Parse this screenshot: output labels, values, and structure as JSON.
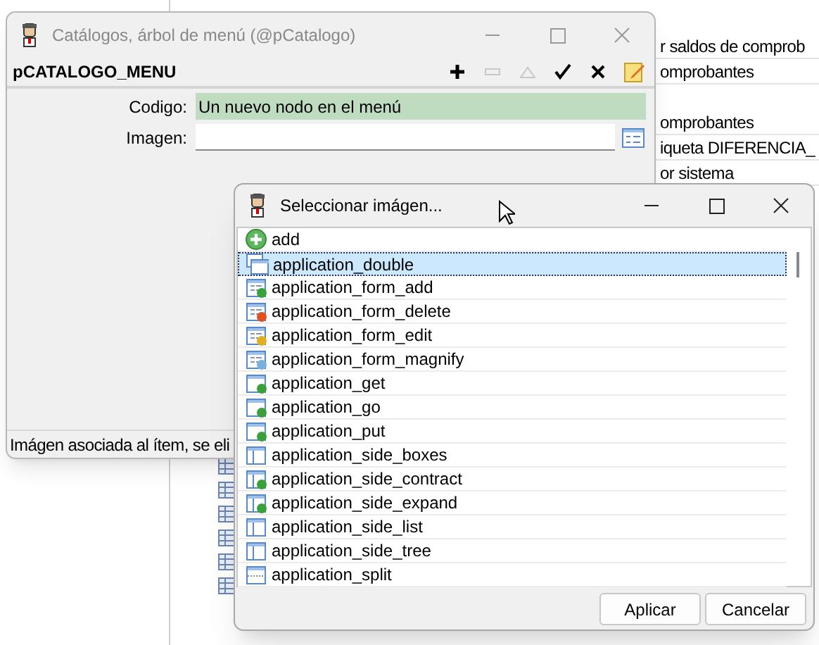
{
  "background": {
    "rows": [
      {
        "text": "r saldos de comprob"
      },
      {
        "text": "omprobantes"
      },
      {
        "text": "omprobantes"
      },
      {
        "text": "iqueta DIFERENCIA_"
      },
      {
        "text": "or sistema"
      }
    ]
  },
  "window": {
    "title": "Catálogos, árbol de menú (@pCatalogo)",
    "header": "pCATALOGO_MENU",
    "tools": [
      {
        "kind": "add",
        "disabled": false
      },
      {
        "kind": "remove",
        "disabled": true
      },
      {
        "kind": "up",
        "disabled": true
      },
      {
        "kind": "accept",
        "disabled": false
      },
      {
        "kind": "cancel",
        "disabled": false
      },
      {
        "kind": "edit",
        "disabled": false
      }
    ],
    "fields": [
      {
        "label": "Codigo:",
        "value": "Un nuevo nodo en el menú",
        "highlighted": true,
        "kind": "text"
      },
      {
        "label": "Imagen:",
        "highlighted": false,
        "kind": "picker"
      }
    ],
    "status_bar": "Imágen asociada al ítem, se eli"
  },
  "dialog": {
    "title": "Seleccionar imágen...",
    "items": [
      {
        "label": "add",
        "kind": "add",
        "selected": false
      },
      {
        "label": "application_double",
        "kind": "double",
        "selected": true
      },
      {
        "label": "application_form_add",
        "kind": "form_add",
        "selected": false
      },
      {
        "label": "application_form_delete",
        "kind": "form_delete",
        "selected": false
      },
      {
        "label": "application_form_edit",
        "kind": "form_edit",
        "selected": false
      },
      {
        "label": "application_form_magnify",
        "kind": "form_magnify",
        "selected": false
      },
      {
        "label": "application_get",
        "kind": "get",
        "selected": false
      },
      {
        "label": "application_go",
        "kind": "go",
        "selected": false
      },
      {
        "label": "application_put",
        "kind": "put",
        "selected": false
      },
      {
        "label": "application_side_boxes",
        "kind": "side_boxes",
        "selected": false
      },
      {
        "label": "application_side_contract",
        "kind": "side_contract",
        "selected": false
      },
      {
        "label": "application_side_expand",
        "kind": "side_expand",
        "selected": false
      },
      {
        "label": "application_side_list",
        "kind": "side_list",
        "selected": false
      },
      {
        "label": "application_side_tree",
        "kind": "side_tree",
        "selected": false
      },
      {
        "label": "application_split",
        "kind": "split",
        "selected": false
      }
    ],
    "buttons": [
      "Aplicar",
      "Cancelar"
    ]
  }
}
